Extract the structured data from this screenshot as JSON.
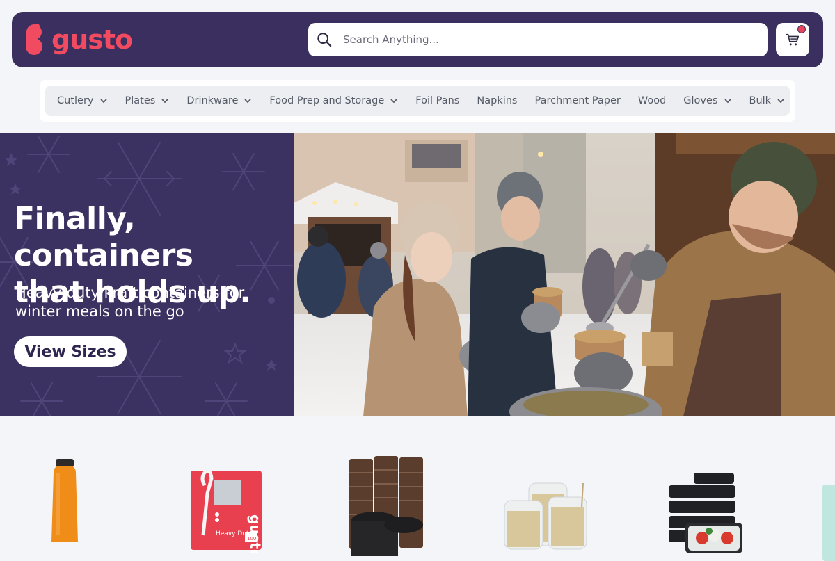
{
  "header": {
    "logo_text": "gusto",
    "search": {
      "placeholder": "Search Anything..."
    },
    "cart": {
      "has_notification": true
    }
  },
  "nav": {
    "items": [
      {
        "label": "Cutlery",
        "has_dropdown": true
      },
      {
        "label": "Plates",
        "has_dropdown": true
      },
      {
        "label": "Drinkware",
        "has_dropdown": true
      },
      {
        "label": "Food Prep and Storage",
        "has_dropdown": true
      },
      {
        "label": "Foil Pans",
        "has_dropdown": false
      },
      {
        "label": "Napkins",
        "has_dropdown": false
      },
      {
        "label": "Parchment Paper",
        "has_dropdown": false
      },
      {
        "label": "Wood",
        "has_dropdown": false
      },
      {
        "label": "Gloves",
        "has_dropdown": true
      },
      {
        "label": "Bulk",
        "has_dropdown": true
      }
    ]
  },
  "hero": {
    "title_line1": "Finally, containers",
    "title_line2": "that holds up.",
    "subtitle_line1": "Heavy-duty kraft containers for",
    "subtitle_line2": "winter meals on the go",
    "cta_label": "View Sizes"
  },
  "products": {
    "items": [
      {
        "image": "juice-bottle"
      },
      {
        "image": "cutlery-box",
        "box_brand": "gusto",
        "box_text": "Heavy Duty",
        "box_count": "100"
      },
      {
        "image": "paper-cups-stack"
      },
      {
        "image": "toothpick-jars"
      },
      {
        "image": "meal-prep-containers"
      }
    ]
  },
  "colors": {
    "brand_dark": "#3a2f5e",
    "brand_red": "#f04b60",
    "background": "#f4f5f8"
  }
}
